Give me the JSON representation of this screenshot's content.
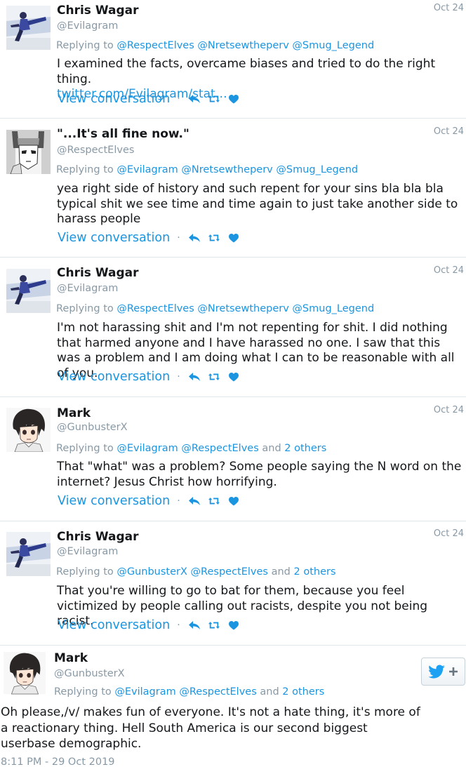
{
  "tweets": [
    {
      "name": "Chris Wagar",
      "handle": "@Evilagram",
      "date": "Oct 24",
      "replying_label": "Replying to",
      "mentions": [
        "@RespectElves",
        "@Nretsewtheperv",
        "@Smug_Legend"
      ],
      "and_label": "",
      "others": "",
      "text": "I examined the facts, overcame biases and tried to do the right thing.",
      "link": "twitter.com/Evilagram/stat…",
      "view_conversation": "View conversation",
      "separator": "·"
    },
    {
      "name": "\"...It's all fine now.\"",
      "handle": "@RespectElves",
      "date": "Oct 24",
      "replying_label": "Replying to",
      "mentions": [
        "@Evilagram",
        "@Nretsewtheperv",
        "@Smug_Legend"
      ],
      "and_label": "",
      "others": "",
      "text": "yea right side of history and such repent for your sins bla bla bla typical shit we see time and time again to just take another side to harass people",
      "link": "",
      "view_conversation": "View conversation",
      "separator": "·"
    },
    {
      "name": "Chris Wagar",
      "handle": "@Evilagram",
      "date": "Oct 24",
      "replying_label": "Replying to",
      "mentions": [
        "@RespectElves",
        "@Nretsewtheperv",
        "@Smug_Legend"
      ],
      "and_label": "",
      "others": "",
      "text": "I'm not harassing shit and I'm not repenting for shit. I did nothing that harmed anyone and I have harassed no one. I saw that this was a problem and I am doing what I can to be reasonable with all of you.",
      "link": "",
      "view_conversation": "View conversation",
      "separator": "·"
    },
    {
      "name": "Mark",
      "handle": "@GunbusterX",
      "date": "Oct 24",
      "replying_label": "Replying to",
      "mentions": [
        "@Evilagram",
        "@RespectElves"
      ],
      "and_label": "and",
      "others": "2 others",
      "text": "That \"what\" was a problem? Some people saying the N word on the internet? Jesus Christ how horrifying.",
      "link": "",
      "view_conversation": "View conversation",
      "separator": "·"
    },
    {
      "name": "Chris Wagar",
      "handle": "@Evilagram",
      "date": "Oct 24",
      "replying_label": "Replying to",
      "mentions": [
        "@GunbusterX",
        "@RespectElves"
      ],
      "and_label": "and",
      "others": "2 others",
      "text": "That you're willing to go to bat for them, because you feel victimized by people calling out racists, despite you not being racist.",
      "link": "",
      "view_conversation": "View conversation",
      "separator": "·"
    }
  ],
  "focused": {
    "name": "Mark",
    "handle": "@GunbusterX",
    "replying_label": "Replying to",
    "mentions": [
      "@Evilagram",
      "@RespectElves"
    ],
    "and_label": "and",
    "others": "2 others",
    "text": "Oh please,/v/ makes fun of everyone. It's not a hate thing, it's more of a reactionary thing. Hell South America is our second biggest userbase demographic.",
    "timestamp": "8:11 PM - 29 Oct 2019",
    "follow_button_icon": "twitter-bird-plus-icon"
  },
  "colors": {
    "link": "#1b95e0",
    "muted": "#8899a6",
    "heart": "#1b95e0",
    "twitter_blue": "#1da1f2"
  }
}
